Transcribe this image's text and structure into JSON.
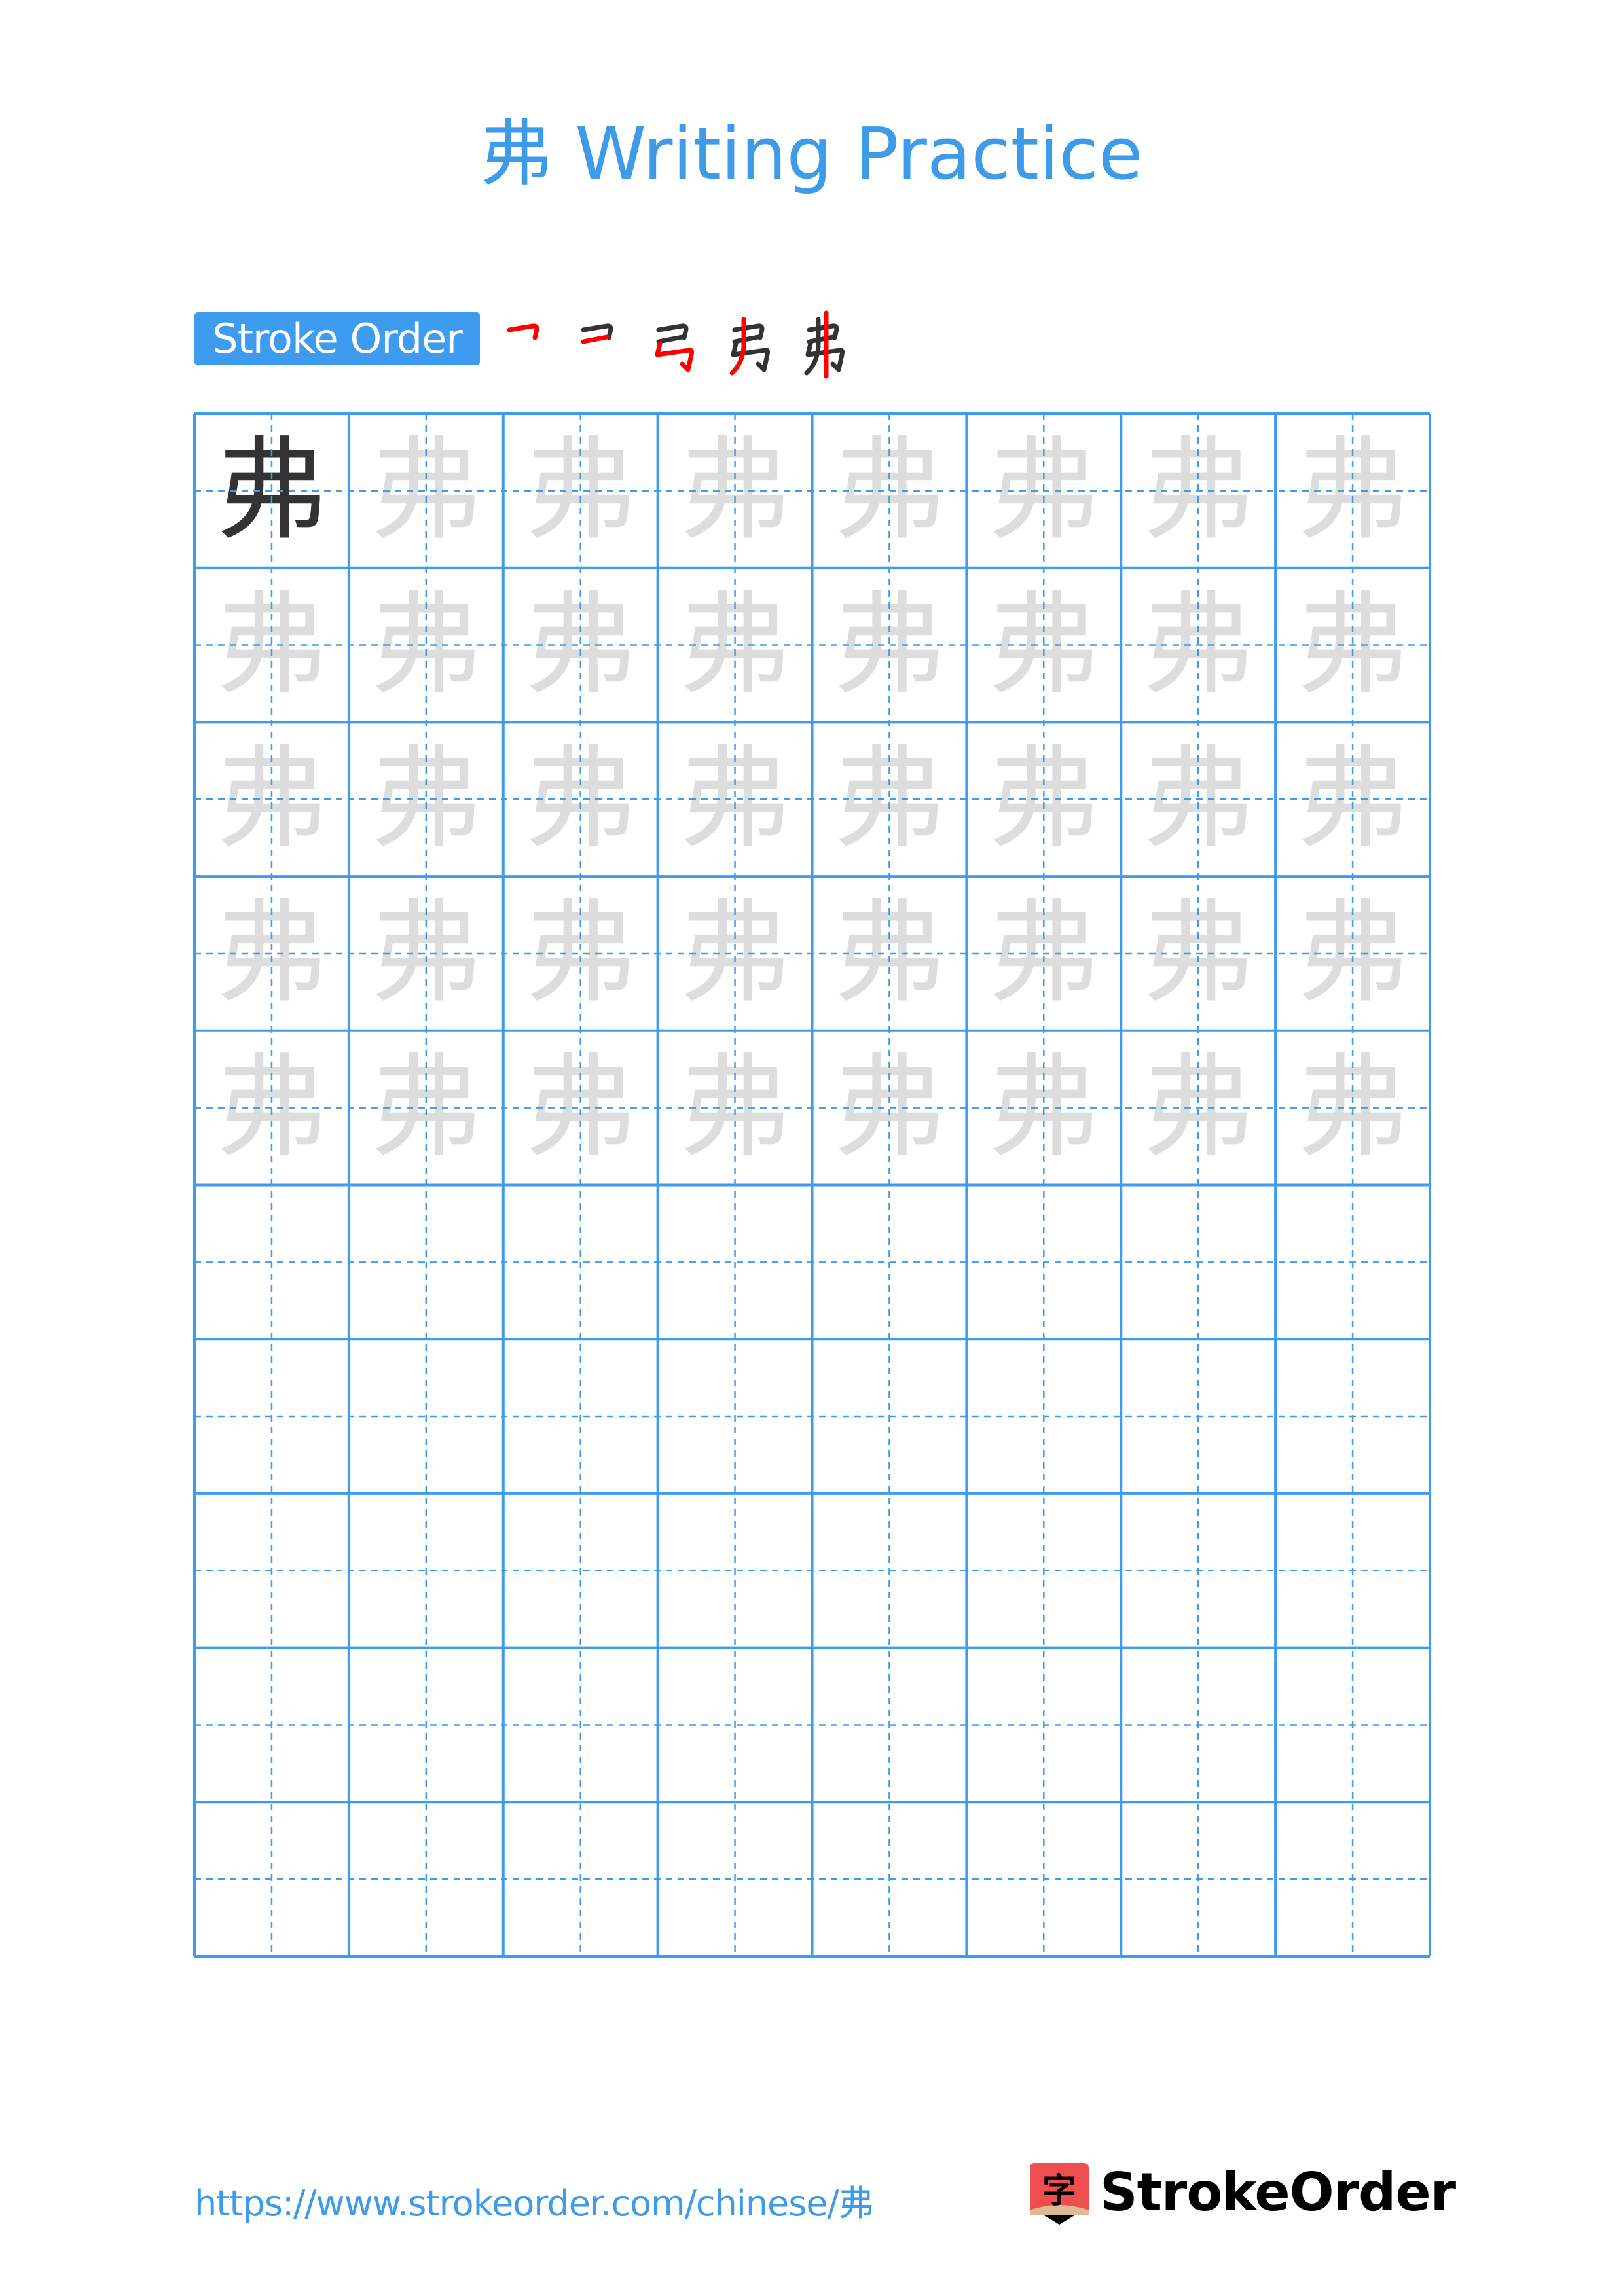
{
  "page": {
    "title": "弗 Writing Practice",
    "character": "弗",
    "colors": {
      "accent": "#3d9bf0",
      "title": "#3d9be9",
      "model_char": "#333333",
      "ghost_char": "#dddddd",
      "stroke_highlight": "#ff0000",
      "logo_red": "#ef4e4e",
      "logo_beige": "#deb992"
    }
  },
  "stroke_order": {
    "label": "Stroke Order",
    "step_count": 5,
    "steps": [
      {
        "step": 1,
        "name": "stroke-1-horizontal-fold"
      },
      {
        "step": 2,
        "name": "stroke-2-horizontal"
      },
      {
        "step": 3,
        "name": "stroke-3-vertical-hook-fold"
      },
      {
        "step": 4,
        "name": "stroke-4-left-falling"
      },
      {
        "step": 5,
        "name": "stroke-5-vertical"
      }
    ]
  },
  "grid": {
    "columns": 8,
    "rows": 10,
    "model_cells": 1,
    "trace_rows": 5,
    "empty_rows": 5
  },
  "footer": {
    "url": "https://www.strokeorder.com/chinese/弗",
    "brand": "StrokeOrder",
    "logo_glyph": "字"
  }
}
